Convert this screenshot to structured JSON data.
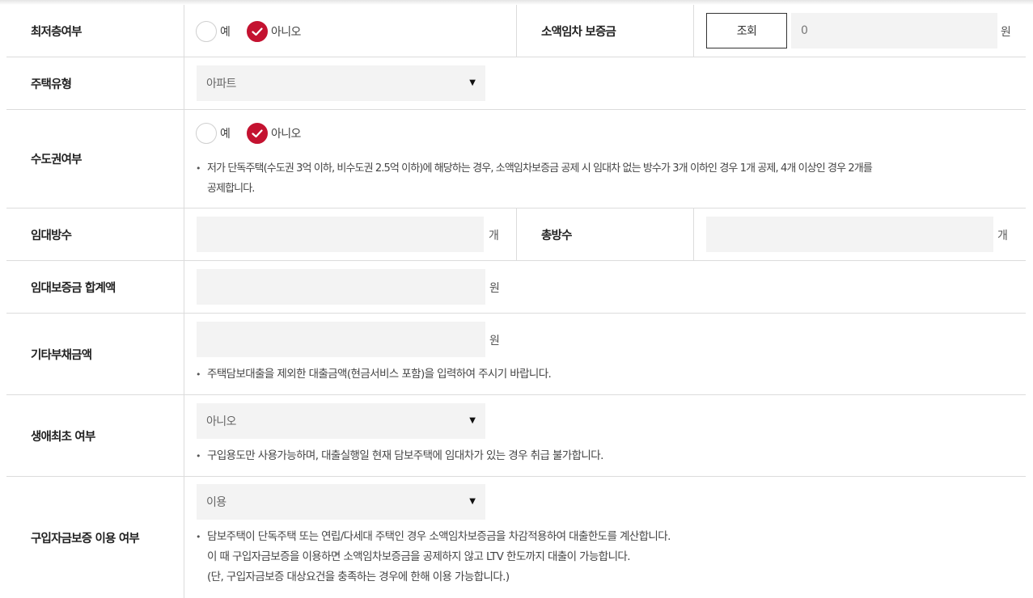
{
  "rows": {
    "lowest_floor": {
      "label": "최저층여부",
      "options": [
        "예",
        "아니오"
      ],
      "selected": "아니오",
      "right_label": "소액임차 보증금",
      "lookup_button": "조회",
      "value": "0",
      "unit": "원"
    },
    "housing_type": {
      "label": "주택유형",
      "selected": "아파트"
    },
    "capital_area": {
      "label": "수도권여부",
      "options": [
        "예",
        "아니오"
      ],
      "selected": "아니오",
      "note_line1": "저가 단독주택(수도권 3억 이하, 비수도권 2.5억 이하)에 해당하는 경우, 소액임차보증금 공제 시 임대차 없는 방수가 3개 이하인 경우 1개 공제, 4개 이상인 경우 2개를",
      "note_line2": "공제합니다."
    },
    "rented_rooms": {
      "label": "임대방수",
      "unit": "개",
      "right_label": "총방수",
      "right_unit": "개"
    },
    "deposit_total": {
      "label": "임대보증금 합계액",
      "unit": "원"
    },
    "other_debt": {
      "label": "기타부채금액",
      "unit": "원",
      "note": "주택담보대출을 제외한 대출금액(현금서비스 포함)을 입력하여 주시기 바랍니다."
    },
    "first_time": {
      "label": "생애최초 여부",
      "selected": "아니오",
      "note": "구입용도만 사용가능하며, 대출실행일 현재 담보주택에 임대차가 있는 경우 취급 불가합니다."
    },
    "purchase_guarantee": {
      "label": "구입자금보증 이용 여부",
      "selected": "이용",
      "note_line1": "담보주택이 단독주택 또는 연립/다세대 주택인 경우 소액임차보증금을 차감적용하여 대출한도를 계산합니다.",
      "note_line2": "이 때 구입자금보증을 이용하면 소액임차보증금을 공제하지 않고 LTV 한도까지 대출이 가능합니다.",
      "note_line3": "(단, 구입자금보증 대상요건을 충족하는 경우에 한해 이용 가능합니다.)"
    }
  },
  "colors": {
    "accent": "#c41230",
    "field_bg": "#f3f3f3",
    "border": "#dcdcdc"
  },
  "icons": {
    "check": "check-icon",
    "dropdown": "triangle-down-icon"
  }
}
